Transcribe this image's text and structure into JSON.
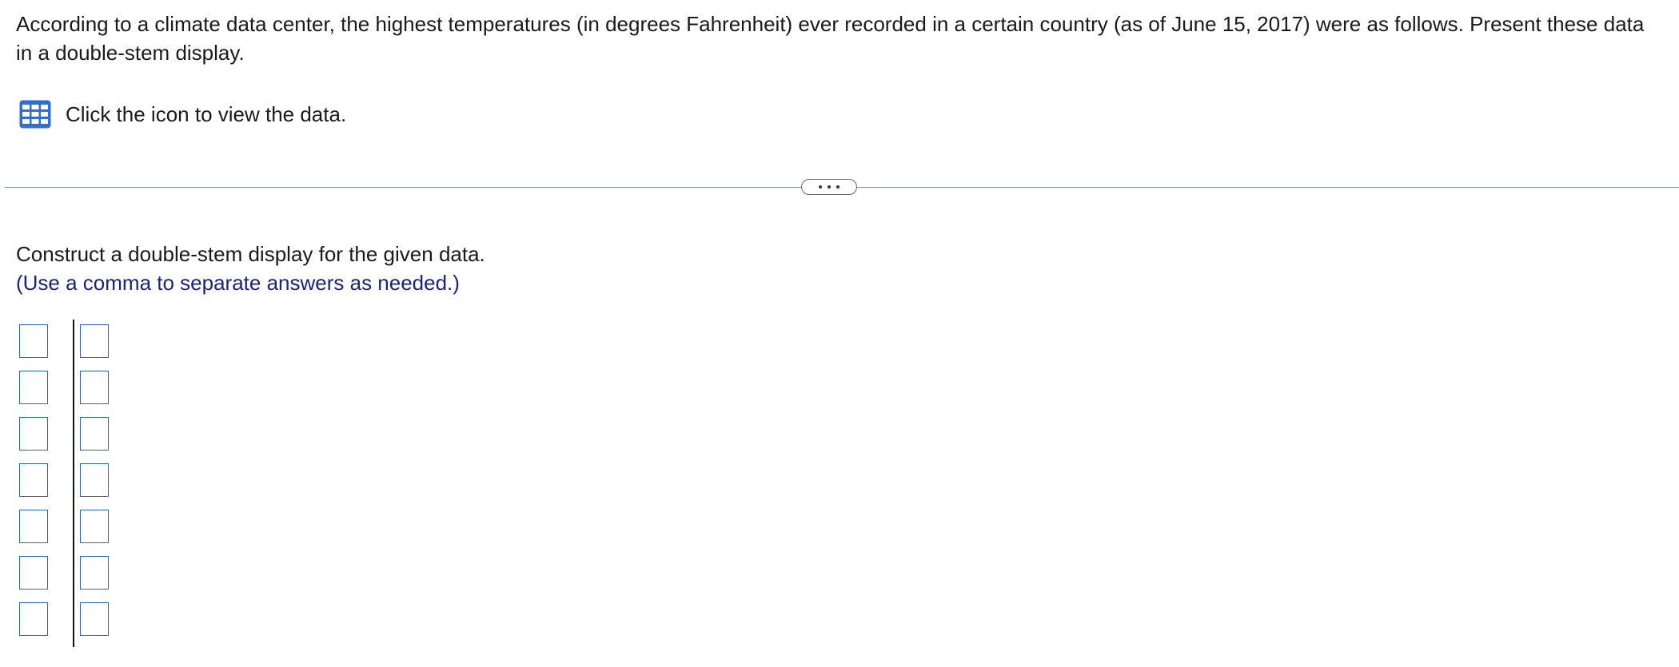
{
  "problem": {
    "text": "According to a climate data center, the highest temperatures (in degrees Fahrenheit) ever recorded in a certain country (as of June 15, 2017) were as follows. Present these data in a double-stem display."
  },
  "data_link": {
    "icon": "table-icon",
    "text": "Click the icon to view the data."
  },
  "divider": {
    "more_icon": "ellipsis-icon"
  },
  "question": {
    "instruction": "Construct a double-stem display for the given data.",
    "hint": "(Use a comma to separate answers as needed.)"
  },
  "stem_leaf": {
    "rows": [
      {
        "stem": "",
        "leaves": ""
      },
      {
        "stem": "",
        "leaves": ""
      },
      {
        "stem": "",
        "leaves": ""
      },
      {
        "stem": "",
        "leaves": ""
      },
      {
        "stem": "",
        "leaves": ""
      },
      {
        "stem": "",
        "leaves": ""
      },
      {
        "stem": "",
        "leaves": ""
      }
    ]
  },
  "colors": {
    "hint_text": "#1a237e",
    "input_border": "#2b64c8",
    "icon_blue": "#2f6fd0",
    "divider": "#7a8aa3"
  }
}
